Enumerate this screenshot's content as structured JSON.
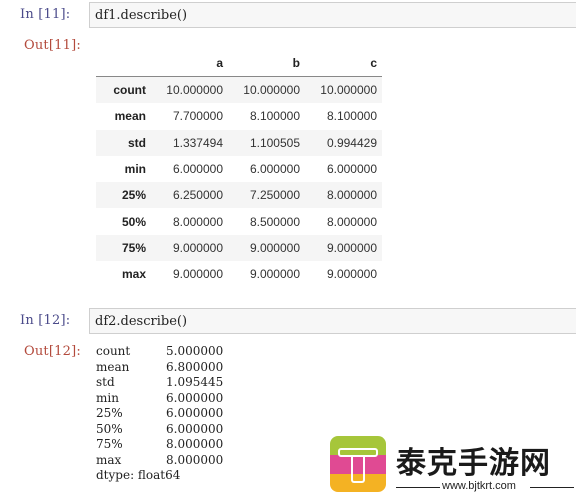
{
  "cells": [
    {
      "in_prompt": "In  [11]:",
      "code": "df1.describe()",
      "out_prompt": "Out[11]:",
      "table": {
        "columns": [
          "",
          "a",
          "b",
          "c"
        ],
        "rows": [
          {
            "label": "count",
            "values": [
              "10.000000",
              "10.000000",
              "10.000000"
            ]
          },
          {
            "label": "mean",
            "values": [
              "7.700000",
              "8.100000",
              "8.100000"
            ]
          },
          {
            "label": "std",
            "values": [
              "1.337494",
              "1.100505",
              "0.994429"
            ]
          },
          {
            "label": "min",
            "values": [
              "6.000000",
              "6.000000",
              "6.000000"
            ]
          },
          {
            "label": "25%",
            "values": [
              "6.250000",
              "7.250000",
              "8.000000"
            ]
          },
          {
            "label": "50%",
            "values": [
              "8.000000",
              "8.500000",
              "8.000000"
            ]
          },
          {
            "label": "75%",
            "values": [
              "9.000000",
              "9.000000",
              "9.000000"
            ]
          },
          {
            "label": "max",
            "values": [
              "9.000000",
              "9.000000",
              "9.000000"
            ]
          }
        ]
      }
    },
    {
      "in_prompt": "In  [12]:",
      "code": "df2.describe()",
      "out_prompt": "Out[12]:",
      "series": [
        {
          "key": "count",
          "value": "5.000000"
        },
        {
          "key": "mean",
          "value": "6.800000"
        },
        {
          "key": "std",
          "value": "1.095445"
        },
        {
          "key": "min",
          "value": "6.000000"
        },
        {
          "key": "25%",
          "value": "6.000000"
        },
        {
          "key": "50%",
          "value": "6.000000"
        },
        {
          "key": "75%",
          "value": "8.000000"
        },
        {
          "key": "max",
          "value": "8.000000"
        }
      ],
      "dtype": "dtype: float64"
    }
  ],
  "watermark": {
    "title": "泰克手游网",
    "url": "www.bjtkrt.com",
    "colors": {
      "green": "#a6c63a",
      "pink": "#e04a93",
      "orange": "#f4b223"
    }
  }
}
